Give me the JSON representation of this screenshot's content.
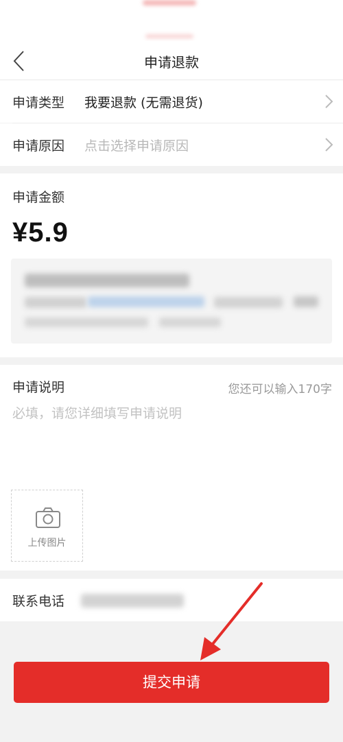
{
  "nav": {
    "title": "申请退款"
  },
  "form": {
    "type_label": "申请类型",
    "type_value": "我要退款 (无需退货)",
    "reason_label": "申请原因",
    "reason_placeholder": "点击选择申请原因"
  },
  "amount": {
    "label": "申请金额",
    "value": "¥5.9"
  },
  "description": {
    "label": "申请说明",
    "counter": "您还可以输入170字",
    "placeholder": "必填，请您详细填写申请说明",
    "upload_label": "上传图片"
  },
  "contact": {
    "label": "联系电话"
  },
  "submit": {
    "label": "提交申请"
  },
  "colors": {
    "accent": "#e42d29"
  }
}
